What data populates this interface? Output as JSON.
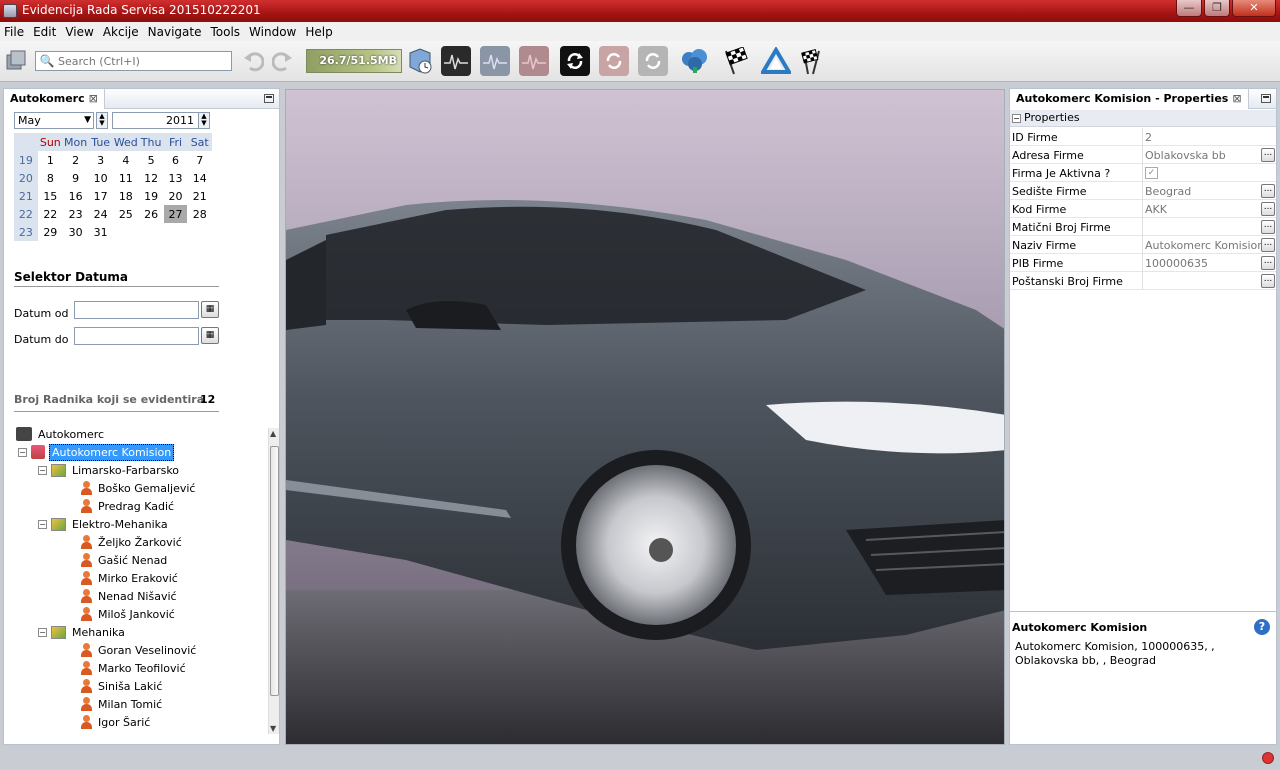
{
  "window": {
    "title": "Evidencija Rada Servisa 201510222201",
    "minimize": "—",
    "maximize": "❐",
    "close": "✕"
  },
  "menu": [
    "File",
    "Edit",
    "View",
    "Akcije",
    "Navigate",
    "Tools",
    "Window",
    "Help"
  ],
  "toolbar": {
    "search_placeholder": "Search (Ctrl+I)",
    "memory": "26.7/51.5MB"
  },
  "left_panel": {
    "tab_title": "Autokomerc",
    "calendar": {
      "month": "May",
      "year": "2011",
      "day_headers": [
        "Sun",
        "Mon",
        "Tue",
        "Wed",
        "Thu",
        "Fri",
        "Sat"
      ],
      "weeks": [
        {
          "week": "19",
          "days": [
            "1",
            "2",
            "3",
            "4",
            "5",
            "6",
            "7"
          ]
        },
        {
          "week": "20",
          "days": [
            "8",
            "9",
            "10",
            "11",
            "12",
            "13",
            "14"
          ]
        },
        {
          "week": "21",
          "days": [
            "15",
            "16",
            "17",
            "18",
            "19",
            "20",
            "21"
          ]
        },
        {
          "week": "22",
          "days": [
            "22",
            "23",
            "24",
            "25",
            "26",
            "27",
            "28"
          ]
        },
        {
          "week": "23",
          "days": [
            "29",
            "30",
            "31",
            "",
            "",
            "",
            ""
          ]
        }
      ],
      "selected_day": "27"
    },
    "date_selector": {
      "title": "Selektor Datuma",
      "from_label": "Datum od",
      "to_label": "Datum do",
      "from_value": "",
      "to_value": ""
    },
    "worker_count_label": "Broj Radnika koji se evidentira",
    "worker_count": "12",
    "tree": {
      "root": "Autokomerc",
      "company": "Autokomerc Komision",
      "groups": [
        {
          "name": "Limarsko-Farbarsko",
          "members": [
            "Boško Gemaljević",
            "Predrag Kadić"
          ]
        },
        {
          "name": "Elektro-Mehanika",
          "members": [
            "Željko Žarković",
            "Gašić Nenad",
            "Mirko  Eraković",
            "Nenad Nišavić",
            "Miloš Janković"
          ]
        },
        {
          "name": "Mehanika",
          "members": [
            "Goran Veselinović",
            "Marko Teofilović",
            "Siniša Lakić",
            "Milan Tomić",
            "Igor Šarić"
          ]
        }
      ]
    }
  },
  "properties": {
    "tab_title": "Autokomerc Komision - Properties",
    "section": "Properties",
    "rows": [
      {
        "key": "ID Firme",
        "value": "2",
        "editor": false
      },
      {
        "key": "Adresa Firme",
        "value": "Oblakovska bb",
        "editor": true
      },
      {
        "key": "Firma Je Aktivna ?",
        "value": "✓",
        "editor": false
      },
      {
        "key": "Sedište Firme",
        "value": "Beograd",
        "editor": true
      },
      {
        "key": "Kod Firme",
        "value": "AKK",
        "editor": true
      },
      {
        "key": "Matični Broj Firme",
        "value": "",
        "editor": true
      },
      {
        "key": "Naziv Firme",
        "value": "Autokomerc Komision",
        "editor": true
      },
      {
        "key": "PIB Firme",
        "value": "100000635",
        "editor": true
      },
      {
        "key": "Poštanski Broj Firme",
        "value": "",
        "editor": true
      }
    ],
    "description_title": "Autokomerc Komision",
    "description_text": "Autokomerc Komision, 100000635, , Oblakovska bb, , Beograd"
  }
}
